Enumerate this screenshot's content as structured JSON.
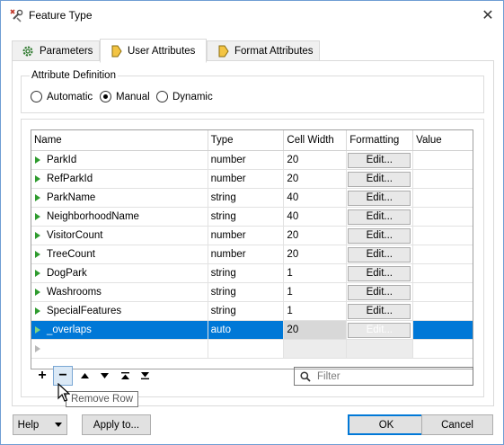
{
  "window": {
    "title": "Feature Type",
    "close": "✕"
  },
  "tabs": [
    {
      "label": "Parameters",
      "icon": "gear-icon"
    },
    {
      "label": "User Attributes",
      "icon": "tag-icon"
    },
    {
      "label": "Format Attributes",
      "icon": "tag-icon"
    }
  ],
  "attribute_definition": {
    "label": "Attribute Definition",
    "options": [
      "Automatic",
      "Manual",
      "Dynamic"
    ],
    "selected": "Manual"
  },
  "table": {
    "columns": [
      "Name",
      "Type",
      "Cell Width",
      "Formatting",
      "Value"
    ],
    "edit_label": "Edit...",
    "rows": [
      {
        "name": "ParkId",
        "type": "number",
        "width": "20"
      },
      {
        "name": "RefParkId",
        "type": "number",
        "width": "20"
      },
      {
        "name": "ParkName",
        "type": "string",
        "width": "40"
      },
      {
        "name": "NeighborhoodName",
        "type": "string",
        "width": "40"
      },
      {
        "name": "VisitorCount",
        "type": "number",
        "width": "20"
      },
      {
        "name": "TreeCount",
        "type": "number",
        "width": "20"
      },
      {
        "name": "DogPark",
        "type": "string",
        "width": "1"
      },
      {
        "name": "Washrooms",
        "type": "string",
        "width": "1"
      },
      {
        "name": "SpecialFeatures",
        "type": "string",
        "width": "1"
      },
      {
        "name": "_overlaps",
        "type": "auto",
        "width": "20"
      }
    ],
    "selected_row": 9
  },
  "toolbar": {
    "add": "+",
    "remove": "−",
    "filter_placeholder": "Filter",
    "tooltip": "Remove Row"
  },
  "footer": {
    "help": "Help",
    "apply": "Apply to...",
    "ok": "OK",
    "cancel": "Cancel"
  },
  "colors": {
    "selection": "#0078d7",
    "attribute_arrow": "#2e9b2e",
    "accent": "#0078d7"
  }
}
